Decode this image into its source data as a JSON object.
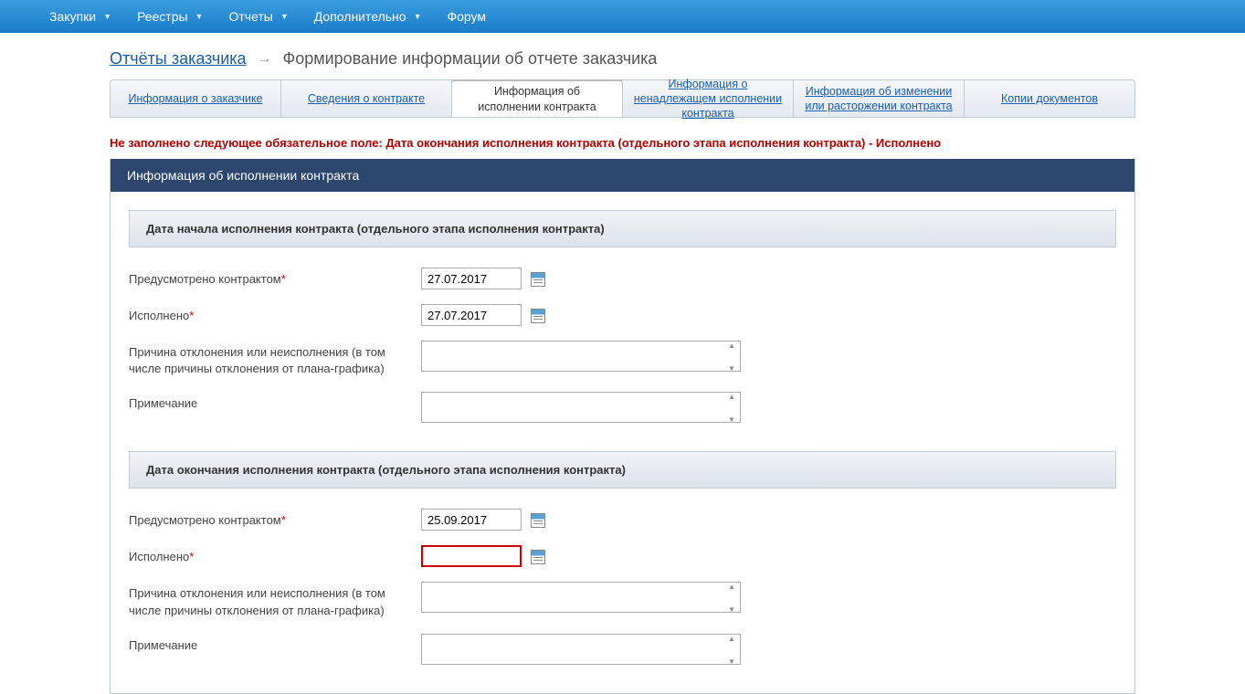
{
  "topNav": {
    "items": [
      "Закупки",
      "Реестры",
      "Отчеты",
      "Дополнительно"
    ],
    "forum": "Форум"
  },
  "breadcrumb": {
    "root": "Отчёты заказчика",
    "current": "Формирование информации об отчете заказчика"
  },
  "tabs": [
    {
      "label": "Информация о заказчике",
      "active": false
    },
    {
      "label": "Сведения о контракте",
      "active": false
    },
    {
      "label": "Информация об исполнении контракта",
      "active": true
    },
    {
      "label": "Информация о ненадлежащем исполнении контракта",
      "active": false
    },
    {
      "label": "Информация об изменении или расторжении контракта",
      "active": false
    },
    {
      "label": "Копии документов",
      "active": false
    }
  ],
  "errorMessage": "Не заполнено следующее обязательное поле: Дата окончания исполнения контракта (отдельного этапа исполнения контракта) - Исполнено",
  "sectionTitle": "Информация об исполнении контракта",
  "block1": {
    "title": "Дата начала исполнения контракта (отдельного этапа исполнения контракта)",
    "rows": {
      "predusm": {
        "label": "Предусмотрено контрактом",
        "value": "27.07.2017"
      },
      "ispoln": {
        "label": "Исполнено",
        "value": "27.07.2017"
      },
      "prich": {
        "label": "Причина отклонения или неисполнения (в том числе причины отклонения от плана-графика)",
        "value": ""
      },
      "prim": {
        "label": "Примечание",
        "value": ""
      }
    }
  },
  "block2": {
    "title": "Дата окончания исполнения контракта (отдельного этапа исполнения контракта)",
    "rows": {
      "predusm": {
        "label": "Предусмотрено контрактом",
        "value": "25.09.2017"
      },
      "ispoln": {
        "label": "Исполнено",
        "value": ""
      },
      "prich": {
        "label": "Причина отклонения или неисполнения (в том числе причины отклонения от плана-графика)",
        "value": ""
      },
      "prim": {
        "label": "Примечание",
        "value": ""
      }
    }
  }
}
